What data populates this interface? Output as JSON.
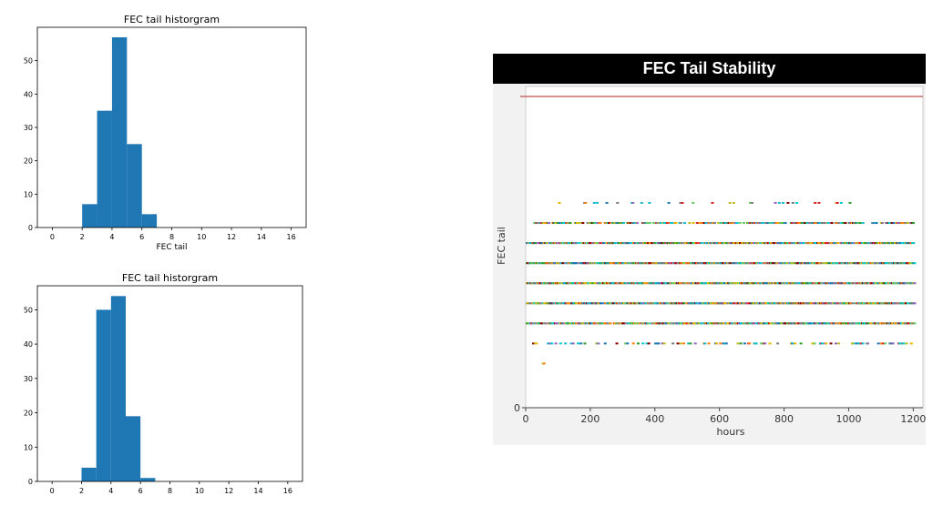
{
  "chart_data": [
    {
      "type": "bar",
      "title": "FEC tail historgram",
      "xlabel": "FEC tail",
      "ylabel": "",
      "xlim": [
        -1,
        17
      ],
      "ylim": [
        0,
        60
      ],
      "xticks": [
        "0",
        "2",
        "4",
        "6",
        "8",
        "10",
        "12",
        "14",
        "16"
      ],
      "yticks": [
        "0",
        "10",
        "20",
        "30",
        "40",
        "50"
      ],
      "bins": [
        2,
        3,
        4,
        5,
        6,
        7
      ],
      "values": [
        7,
        35,
        57,
        25,
        4
      ],
      "color": "#1f77b4"
    },
    {
      "type": "bar",
      "title": "FEC tail historgram",
      "xlabel": "",
      "ylabel": "",
      "xlim": [
        -1,
        17
      ],
      "ylim": [
        0,
        57
      ],
      "xticks": [
        "0",
        "2",
        "4",
        "6",
        "8",
        "10",
        "12",
        "14",
        "16"
      ],
      "yticks": [
        "0",
        "10",
        "20",
        "30",
        "40",
        "50"
      ],
      "bins": [
        2,
        3,
        4,
        5,
        6,
        7
      ],
      "values": [
        4,
        50,
        54,
        19,
        1
      ],
      "color": "#1f77b4"
    },
    {
      "type": "scatter",
      "title": "FEC Tail Stability",
      "xlabel": "hours",
      "ylabel": "FEC tail",
      "xlim": [
        0,
        1230
      ],
      "ylim": [
        0,
        16
      ],
      "xticks": [
        "0",
        "200",
        "400",
        "600",
        "800",
        "1000",
        "1200"
      ],
      "yticks": [
        "0"
      ],
      "limit_line": {
        "y": 15.5,
        "color": "#b22222"
      },
      "levels": [
        {
          "y": 10.2,
          "x_start": 40,
          "x_end": 1000,
          "density": 0.12
        },
        {
          "y": 9.2,
          "x_start": 20,
          "x_end": 1200,
          "density": 0.55
        },
        {
          "y": 8.2,
          "x_start": 0,
          "x_end": 1200,
          "density": 0.85
        },
        {
          "y": 7.2,
          "x_start": 0,
          "x_end": 1200,
          "density": 0.9
        },
        {
          "y": 6.2,
          "x_start": 0,
          "x_end": 1200,
          "density": 0.95
        },
        {
          "y": 5.2,
          "x_start": 0,
          "x_end": 1200,
          "density": 0.9
        },
        {
          "y": 4.2,
          "x_start": 0,
          "x_end": 1200,
          "density": 0.85
        },
        {
          "y": 3.2,
          "x_start": 20,
          "x_end": 1200,
          "density": 0.25
        },
        {
          "y": 2.2,
          "x_start": 50,
          "x_end": 55,
          "density": 1.0
        }
      ],
      "point_colors": [
        "#2ca02c",
        "#d62728",
        "#9467bd",
        "#17becf",
        "#bcbd22",
        "#e6b800",
        "#1f77b4",
        "#7f7f7f",
        "#ff7f0e",
        "#8b0000",
        "#66cc66",
        "#00ced1"
      ],
      "background": "#ffffff",
      "frame_color": "#cccccc"
    }
  ]
}
